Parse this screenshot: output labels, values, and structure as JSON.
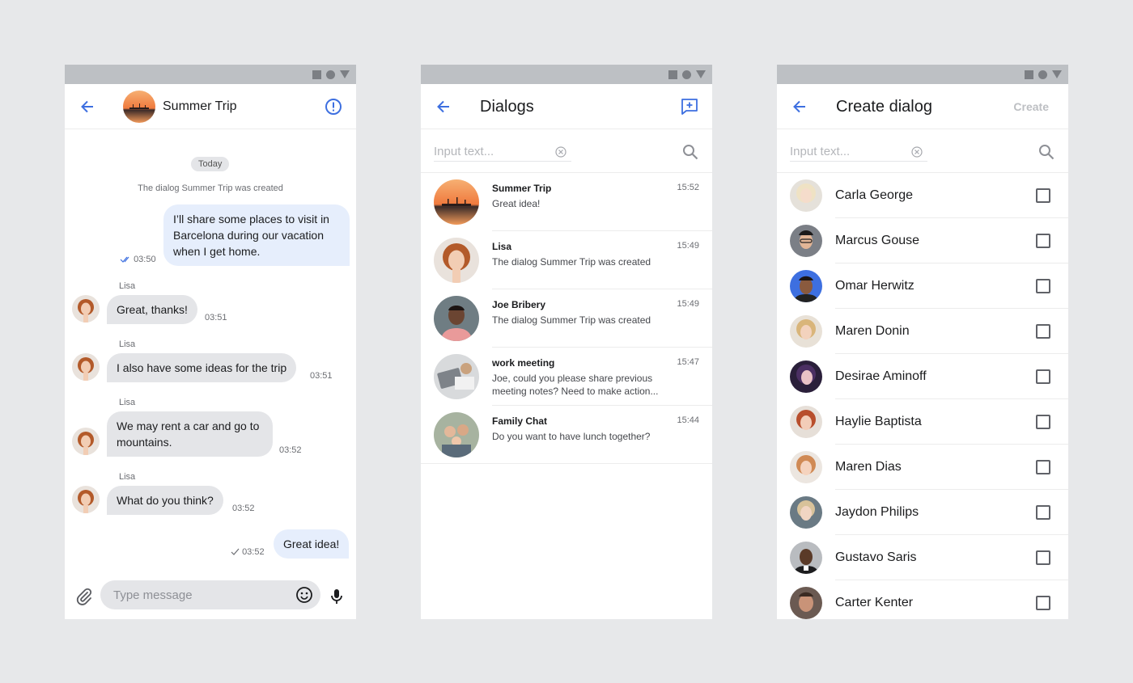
{
  "chat": {
    "title": "Summer Trip",
    "date_label": "Today",
    "system_message": "The dialog Summer Trip was created",
    "messages": [
      {
        "direction": "out",
        "text": "I’ll share some places to visit in Barcelona during our vacation when I get home.",
        "time": "03:50",
        "status": "read"
      },
      {
        "direction": "in",
        "sender": "Lisa",
        "text": "Great, thanks!",
        "time": "03:51"
      },
      {
        "direction": "in",
        "sender": "Lisa",
        "text": "I also have some ideas for the trip",
        "time": "03:51"
      },
      {
        "direction": "in",
        "sender": "Lisa",
        "text": "We may rent a car and go to mountains.",
        "time": "03:52"
      },
      {
        "direction": "in",
        "sender": "Lisa",
        "text": "What do you think?",
        "time": "03:52"
      },
      {
        "direction": "out",
        "text": "Great idea!",
        "time": "03:52",
        "status": "sent"
      }
    ],
    "input_placeholder": "Type message"
  },
  "dialogs": {
    "title": "Dialogs",
    "search_placeholder": "Input text...",
    "items": [
      {
        "name": "Summer Trip",
        "time": "15:52",
        "last_message": "Great idea!"
      },
      {
        "name": "Lisa",
        "time": "15:49",
        "last_message": "The dialog Summer Trip was created"
      },
      {
        "name": "Joe Bribery",
        "time": "15:49",
        "last_message": "The dialog Summer Trip was created"
      },
      {
        "name": "work meeting",
        "time": "15:47",
        "last_message": "Joe, could you please share previous meeting notes? Need to make action..."
      },
      {
        "name": "Family Chat",
        "time": "15:44",
        "last_message": "Do you want to have lunch together?"
      }
    ]
  },
  "create_dialog": {
    "title": "Create dialog",
    "create_label": "Create",
    "search_placeholder": "Input text...",
    "users": [
      {
        "name": "Carla George",
        "checked": false
      },
      {
        "name": "Marcus Gouse",
        "checked": false
      },
      {
        "name": "Omar Herwitz",
        "checked": false
      },
      {
        "name": "Maren Donin",
        "checked": false
      },
      {
        "name": "Desirae Aminoff",
        "checked": false
      },
      {
        "name": "Haylie Baptista",
        "checked": false
      },
      {
        "name": "Maren Dias",
        "checked": false
      },
      {
        "name": "Jaydon Philips",
        "checked": false
      },
      {
        "name": "Gustavo Saris",
        "checked": false
      },
      {
        "name": "Carter Kenter",
        "checked": false
      }
    ]
  },
  "colors": {
    "accent": "#3d6fe0",
    "outgoing_bubble": "#e6eefc",
    "incoming_bubble": "#e4e5e8",
    "status_bar": "#bdc0c4"
  }
}
